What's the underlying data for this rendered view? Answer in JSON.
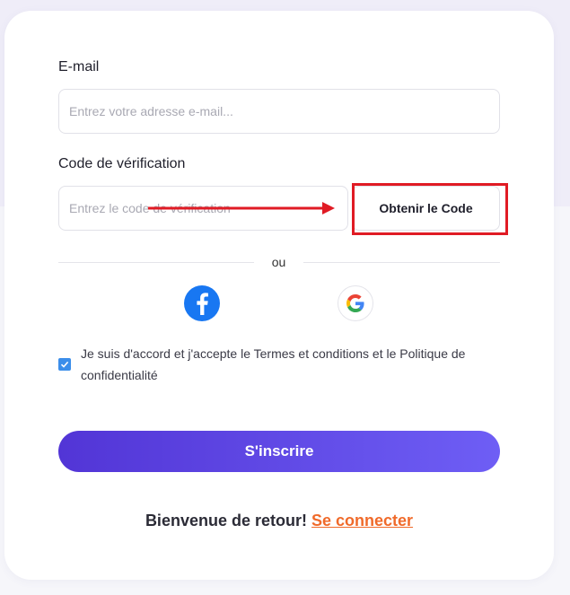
{
  "form": {
    "email_label": "E-mail",
    "email_placeholder": "Entrez votre adresse e-mail...",
    "email_value": "",
    "code_label": "Code de vérification",
    "code_placeholder": "Entrez le code de vérification",
    "code_value": "",
    "get_code_button": "Obtenir le Code",
    "divider_text": "ou",
    "agree_checked": true,
    "agree_text": "Je suis d'accord et j'accepte le Termes et conditions et le Politique de confidentialité",
    "submit_label": "S'inscrire",
    "welcome_text": "Bienvenue de retour!",
    "login_link": "Se connecter"
  },
  "social": {
    "facebook_icon": "facebook-icon",
    "google_icon": "google-icon"
  },
  "annotation": {
    "highlight_color": "#e01b24"
  },
  "colors": {
    "primary_gradient_start": "#5235d6",
    "primary_gradient_end": "#6e5ef5",
    "link": "#f06a2a",
    "checkbox": "#3b8eea",
    "facebook": "#1877f2"
  }
}
